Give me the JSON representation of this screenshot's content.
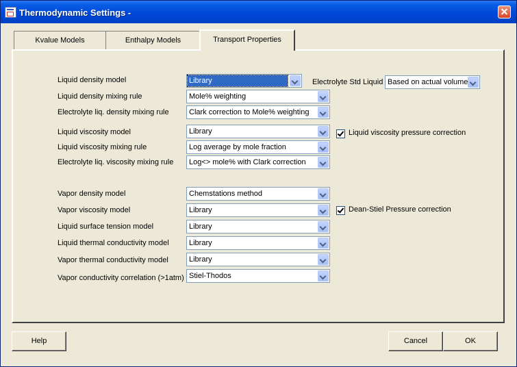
{
  "window": {
    "title": "Thermodynamic Settings -",
    "icon": "app-icon",
    "close_icon": "close-icon"
  },
  "tabs": [
    {
      "label": "Kvalue Models",
      "active": false
    },
    {
      "label": "Enthalpy Models",
      "active": false
    },
    {
      "label": "Transport Properties",
      "active": true
    }
  ],
  "rows": [
    {
      "label": "Liquid density model",
      "value": "Library",
      "selected": true
    },
    {
      "label": "Liquid density mixing rule",
      "value": "Mole% weighting"
    },
    {
      "label": "Electrolyte liq. density mixing rule",
      "value": "Clark correction to Mole% weighting"
    },
    {
      "label": "Liquid viscosity model",
      "value": "Library"
    },
    {
      "label": "Liquid viscosity mixing rule",
      "value": "Log average by mole fraction"
    },
    {
      "label": "Electrolyte liq. viscosity mixing rule",
      "value": "Log<> mole% with Clark correction"
    },
    {
      "label": "Vapor density model",
      "value": "Chemstations method"
    },
    {
      "label": "Vapor viscosity model",
      "value": "Library"
    },
    {
      "label": "Liquid surface tension model",
      "value": "Library"
    },
    {
      "label": "Liquid thermal conductivity model",
      "value": "Library"
    },
    {
      "label": "Vapor thermal conductivity model",
      "value": "Library"
    },
    {
      "label": "Vapor conductivity correlation (>1atm)",
      "value": "Stiel-Thodos"
    }
  ],
  "electrolyte_std": {
    "label": "Electrolyte Std Liquid",
    "value": "Based on actual volume"
  },
  "checkboxes": [
    {
      "label": "Liquid viscosity pressure correction",
      "checked": true
    },
    {
      "label": "Dean-Stiel Pressure correction",
      "checked": true
    }
  ],
  "buttons": {
    "help": "Help",
    "cancel": "Cancel",
    "ok": "OK"
  }
}
